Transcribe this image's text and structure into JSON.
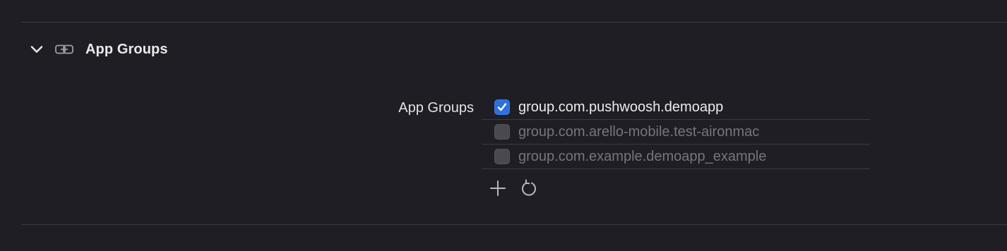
{
  "section": {
    "title": "App Groups",
    "disclosure_icon": "chevron-down-icon",
    "capability_icon": "link-icon"
  },
  "field": {
    "label": "App Groups"
  },
  "groups": [
    {
      "identifier": "group.com.pushwoosh.demoapp",
      "checked": true,
      "enabled": true
    },
    {
      "identifier": "group.com.arello-mobile.test-aironmac",
      "checked": false,
      "enabled": false
    },
    {
      "identifier": "group.com.example.demoapp_example",
      "checked": false,
      "enabled": false
    }
  ],
  "actions": {
    "add_icon": "plus-icon",
    "refresh_icon": "refresh-icon"
  },
  "colors": {
    "background": "#1f1e24",
    "accent": "#2f6fdb",
    "divider": "#3a3940",
    "disabled_text": "#76757c"
  }
}
